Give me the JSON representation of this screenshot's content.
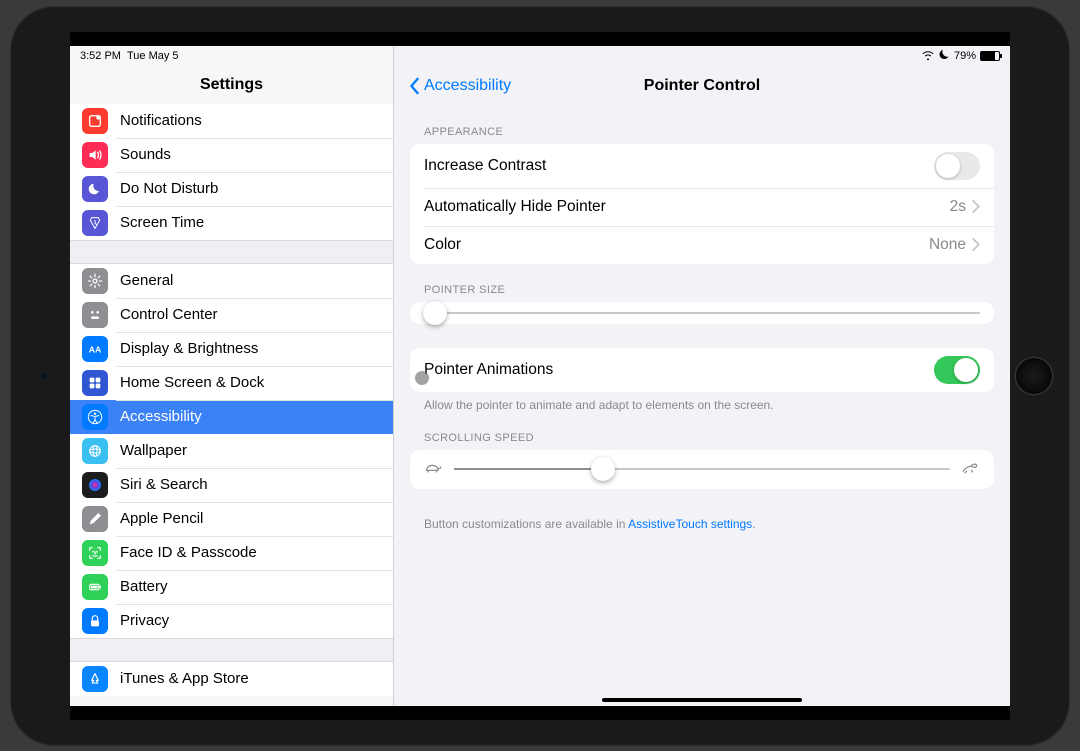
{
  "status": {
    "time": "3:52 PM",
    "date": "Tue May 5",
    "battery_pct": "79%"
  },
  "sidebar": {
    "title": "Settings",
    "items": [
      {
        "label": "Notifications",
        "icon": "notifications",
        "bg": "#ff3b30"
      },
      {
        "label": "Sounds",
        "icon": "sounds",
        "bg": "#ff2d55"
      },
      {
        "label": "Do Not Disturb",
        "icon": "dnd",
        "bg": "#5856d6"
      },
      {
        "label": "Screen Time",
        "icon": "screentime",
        "bg": "#5856d6"
      }
    ],
    "items2": [
      {
        "label": "General",
        "icon": "general",
        "bg": "#8e8e93"
      },
      {
        "label": "Control Center",
        "icon": "control",
        "bg": "#8e8e93"
      },
      {
        "label": "Display & Brightness",
        "icon": "display",
        "bg": "#007aff"
      },
      {
        "label": "Home Screen & Dock",
        "icon": "home",
        "bg": "#3156d4"
      },
      {
        "label": "Accessibility",
        "icon": "accessibility",
        "bg": "#007aff",
        "selected": true
      },
      {
        "label": "Wallpaper",
        "icon": "wallpaper",
        "bg": "#39bff0"
      },
      {
        "label": "Siri & Search",
        "icon": "siri",
        "bg": "#1c1c1e"
      },
      {
        "label": "Apple Pencil",
        "icon": "pencil",
        "bg": "#8e8e93"
      },
      {
        "label": "Face ID & Passcode",
        "icon": "faceid",
        "bg": "#30d158"
      },
      {
        "label": "Battery",
        "icon": "battery",
        "bg": "#30d158"
      },
      {
        "label": "Privacy",
        "icon": "privacy",
        "bg": "#007aff"
      }
    ],
    "items3": [
      {
        "label": "iTunes & App Store",
        "icon": "appstore",
        "bg": "#0a84ff"
      }
    ]
  },
  "detail": {
    "back_label": "Accessibility",
    "title": "Pointer Control",
    "sections": {
      "appearance_header": "APPEARANCE",
      "increase_contrast": "Increase Contrast",
      "auto_hide": "Automatically Hide Pointer",
      "auto_hide_value": "2s",
      "color": "Color",
      "color_value": "None",
      "pointer_size_header": "POINTER SIZE",
      "pointer_animations": "Pointer Animations",
      "pointer_animations_note": "Allow the pointer to animate and adapt to elements on the screen.",
      "scrolling_speed_header": "SCROLLING SPEED",
      "footer_text": "Button customizations are available in ",
      "footer_link": "AssistiveTouch settings",
      "footer_period": "."
    }
  }
}
